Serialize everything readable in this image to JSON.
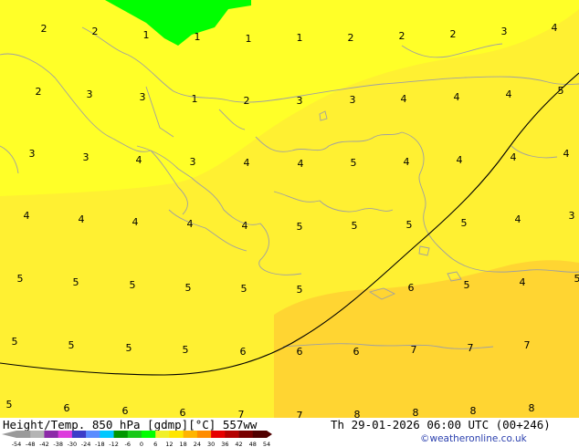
{
  "footer": {
    "title": "Height/Temp. 850 hPa [gdmp][°C] 557ww",
    "timestamp": "Th 29-01-2026 06:00 UTC (00+246)",
    "credit": "©weatheronline.co.uk"
  },
  "colorbar": {
    "ticks": [
      "-54",
      "-48",
      "-42",
      "-38",
      "-30",
      "-24",
      "-18",
      "-12",
      "-6",
      "0",
      "6",
      "12",
      "18",
      "24",
      "30",
      "36",
      "42",
      "48",
      "54"
    ],
    "colors": [
      "#9a9a9a",
      "#b4b4b4",
      "#8c2aa8",
      "#dd3cdd",
      "#3c3cc8",
      "#5a8cff",
      "#00c8ff",
      "#009600",
      "#19c819",
      "#00ff00",
      "#f0f028",
      "#ffe600",
      "#ffb400",
      "#ff8c00",
      "#e60000",
      "#b40000",
      "#780000",
      "#500000"
    ]
  },
  "colors": {
    "field_1_3": "#ffff28",
    "field_4_5": "#fff032",
    "field_6_8": "#ffd532",
    "field_0": "#00ff00",
    "coastline": "#a0a0a0",
    "isoline": "#000000"
  },
  "map_labels": [
    {
      "text": "2"
    },
    {
      "text": "2"
    },
    {
      "text": "1"
    },
    {
      "text": "1"
    },
    {
      "text": "1"
    },
    {
      "text": "1"
    },
    {
      "text": "2"
    },
    {
      "text": "2"
    },
    {
      "text": "2"
    },
    {
      "text": "3"
    },
    {
      "text": "4"
    },
    {
      "text": "2"
    },
    {
      "text": "3"
    },
    {
      "text": "3"
    },
    {
      "text": "1"
    },
    {
      "text": "2"
    },
    {
      "text": "3"
    },
    {
      "text": "3"
    },
    {
      "text": "4"
    },
    {
      "text": "4"
    },
    {
      "text": "4"
    },
    {
      "text": "5"
    },
    {
      "text": "3"
    },
    {
      "text": "3"
    },
    {
      "text": "4"
    },
    {
      "text": "3"
    },
    {
      "text": "4"
    },
    {
      "text": "4"
    },
    {
      "text": "5"
    },
    {
      "text": "4"
    },
    {
      "text": "4"
    },
    {
      "text": "4"
    },
    {
      "text": "4"
    },
    {
      "text": "4"
    },
    {
      "text": "4"
    },
    {
      "text": "4"
    },
    {
      "text": "4"
    },
    {
      "text": "4"
    },
    {
      "text": "5"
    },
    {
      "text": "5"
    },
    {
      "text": "5"
    },
    {
      "text": "5"
    },
    {
      "text": "4"
    },
    {
      "text": "3"
    },
    {
      "text": "5"
    },
    {
      "text": "5"
    },
    {
      "text": "5"
    },
    {
      "text": "5"
    },
    {
      "text": "5"
    },
    {
      "text": "5"
    },
    {
      "text": "6"
    },
    {
      "text": "5"
    },
    {
      "text": "4"
    },
    {
      "text": "5"
    },
    {
      "text": "5"
    },
    {
      "text": "5"
    },
    {
      "text": "5"
    },
    {
      "text": "5"
    },
    {
      "text": "6"
    },
    {
      "text": "6"
    },
    {
      "text": "6"
    },
    {
      "text": "7"
    },
    {
      "text": "7"
    },
    {
      "text": "7"
    },
    {
      "text": "5"
    },
    {
      "text": "6"
    },
    {
      "text": "6"
    },
    {
      "text": "6"
    },
    {
      "text": "7"
    },
    {
      "text": "7"
    },
    {
      "text": "8"
    },
    {
      "text": "8"
    },
    {
      "text": "8"
    },
    {
      "text": "8"
    }
  ]
}
